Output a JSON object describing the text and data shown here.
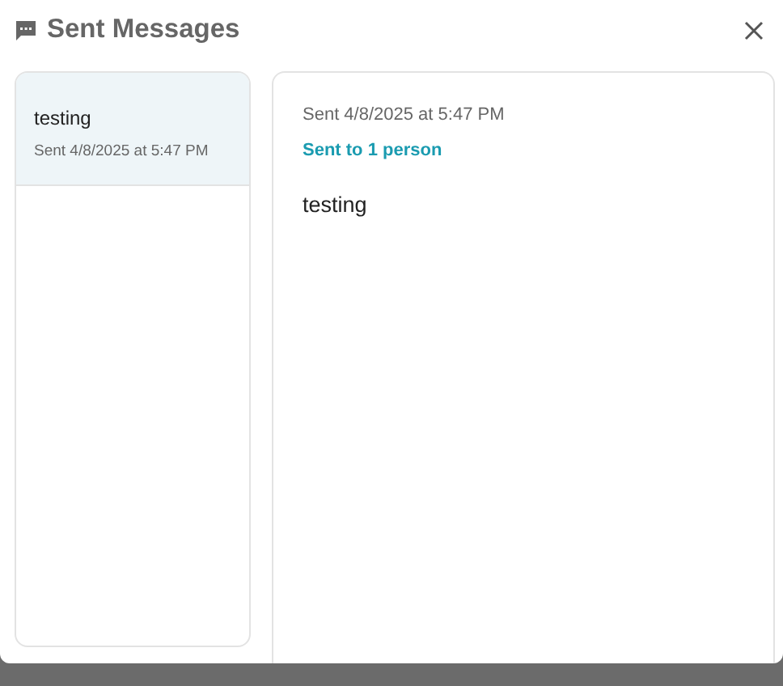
{
  "dialog": {
    "title": "Sent Messages"
  },
  "messages": [
    {
      "text": "testing",
      "sent": "Sent 4/8/2025 at 5:47 PM",
      "selected": true
    }
  ],
  "detail": {
    "sent": "Sent 4/8/2025 at 5:47 PM",
    "recipients": "Sent to 1 person",
    "body": "testing"
  }
}
